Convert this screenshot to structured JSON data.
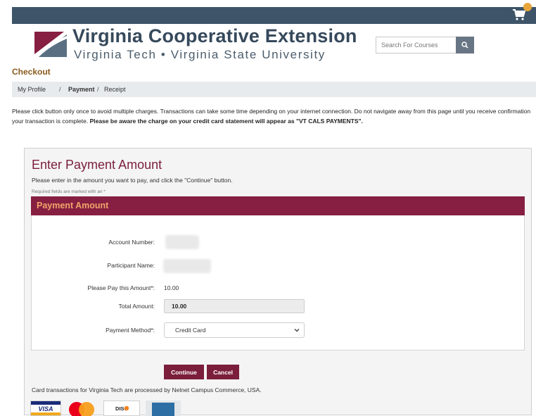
{
  "header": {
    "brand_title": "Virginia Cooperative Extension",
    "brand_subtitle": "Virginia Tech  •  Virginia State University",
    "cart_icon": "shopping-cart-icon",
    "cart_badge_color": "#e8a53a",
    "search": {
      "placeholder": "Search For Courses",
      "button_icon": "search-icon"
    }
  },
  "page": {
    "title": "Checkout",
    "breadcrumb": {
      "items": [
        "My Profile",
        "Payment",
        "Receipt"
      ],
      "separator": "/",
      "active": "Payment"
    },
    "notice": {
      "text": "Please click button only once to avoid multiple charges. Transactions can take some time depending on your internet connection. Do not navigate away from this page until you receive confirmation your transaction is complete.",
      "bold_text": "Please be aware the charge on your credit card statement will appear as \"VT CALS PAYMENTS\"."
    }
  },
  "payment_form": {
    "heading": "Enter Payment Amount",
    "instructions": "Please enter in the amount you want to pay, and click the \"Continue\" button.",
    "required_note": "Required fields are marked with an *",
    "panel_title": "Payment Amount",
    "fields": {
      "account_number_label": "Account Number:",
      "participant_name_label": "Participant Name:",
      "pay_amount_label": "Please Pay this Amount*:",
      "pay_amount_value": "10.00",
      "total_amount_label": "Total Amount:",
      "total_amount_value": "10.00",
      "payment_method_label": "Payment Method*:",
      "payment_method_value": "Credit Card"
    },
    "continue_label": "Continue",
    "cancel_label": "Cancel",
    "processor_text": "Card transactions for Virginia Tech are processed by Nelnet Campus Commerce, USA.",
    "accepted_cards": [
      "VISA",
      "MasterCard",
      "DISCOVER",
      "American Express"
    ]
  },
  "colors": {
    "top_bar": "#3e5468",
    "brand_text": "#36495c",
    "maroon": "#861f41",
    "panel_title_text": "#f2a56b",
    "checkout_title": "#8a5a1e"
  }
}
